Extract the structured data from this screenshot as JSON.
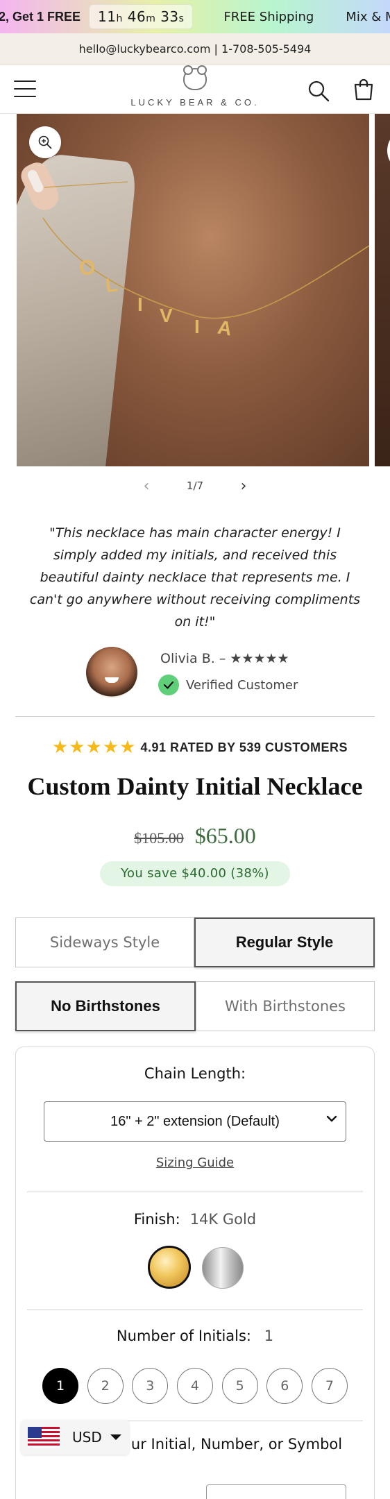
{
  "promo": {
    "offer": "2, Get 1 FREE",
    "timer_hours": "11",
    "timer_minutes": "46",
    "timer_seconds": "33",
    "unit_h": "h",
    "unit_m": "m",
    "unit_s": "s",
    "shipping": "FREE Shipping",
    "mix": "Mix & Mo"
  },
  "contact": {
    "text": "hello@luckybearco.com | 1-708-505-5494"
  },
  "header": {
    "brand": "LUCKY BEAR & CO."
  },
  "gallery": {
    "necklace_letters": [
      "O",
      "L",
      "I",
      "V",
      "I",
      "A"
    ],
    "counter": "1/7"
  },
  "testimonial": {
    "quote": "\"This necklace has main character energy! I simply added my initials, and received this beautiful dainty necklace that represents me. I can't go anywhere without receiving compliments on it!\"",
    "reviewer": "Olivia B. – ★★★★★",
    "verified": "Verified Customer"
  },
  "product": {
    "stars": "★★★★★",
    "rating_text": "4.91 RATED BY 539 CUSTOMERS",
    "title": "Custom Dainty Initial Necklace",
    "compare_price": "$105.00",
    "price": "$65.00",
    "savings": "You save $40.00 (38%)"
  },
  "style_options": [
    {
      "label": "Sideways Style",
      "selected": false
    },
    {
      "label": "Regular Style",
      "selected": true
    }
  ],
  "birthstone_options": [
    {
      "label": "No Birthstones",
      "selected": true
    },
    {
      "label": "With Birthstones",
      "selected": false
    }
  ],
  "options_panel": {
    "chain_label": "Chain Length:",
    "chain_value": "16\" + 2\" extension (Default)",
    "sizing_guide": "Sizing Guide",
    "finish_label": "Finish:",
    "finish_value": "14K Gold",
    "finish_swatches": [
      "Gold",
      "Silver"
    ],
    "initials_label": "Number of Initials:",
    "initials_value": "1",
    "initials_choices": [
      "1",
      "2",
      "3",
      "4",
      "5",
      "6",
      "7"
    ],
    "initials_selected": "1",
    "choose_label": "ur Initial, Number, or Symbol"
  },
  "currency": {
    "code": "USD"
  },
  "colors": {
    "price_green": "#3d6b3f",
    "save_bg": "#e3f5e4",
    "star_gold": "#f6b91a",
    "check_green": "#5fcf7a"
  }
}
